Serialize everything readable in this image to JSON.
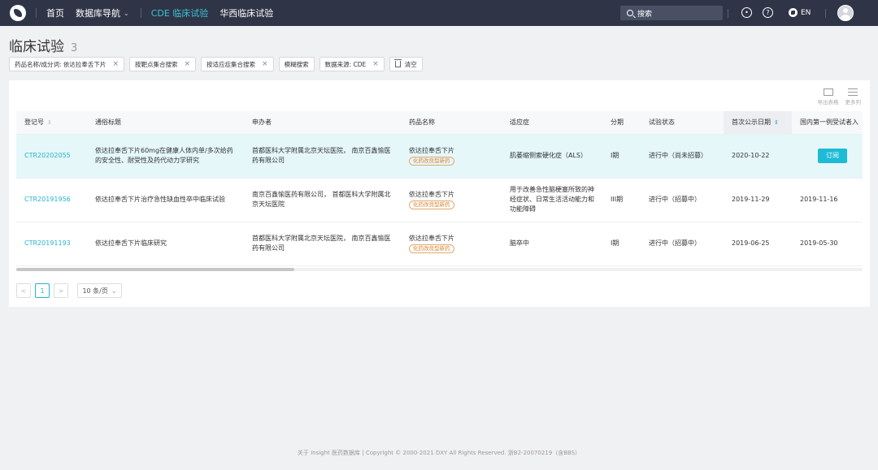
{
  "topbar": {
    "nav": [
      {
        "label": "首页",
        "active": false
      },
      {
        "label": "数据库导航",
        "active": false,
        "dropdown": true
      },
      {
        "label": "CDE 临床试验",
        "active": true
      },
      {
        "label": "华西临床试验",
        "active": false
      }
    ],
    "search_label": "搜索",
    "lang_label": "EN",
    "icons": [
      "logo-icon",
      "search-icon",
      "lightbulb-icon",
      "help-icon",
      "globe-icon",
      "avatar"
    ]
  },
  "page": {
    "title": "临床试验",
    "count": "3"
  },
  "filters": [
    {
      "label": "药品名称/成分词: 依达拉奉舌下片",
      "closable": true
    },
    {
      "label": "按靶点集合搜索",
      "closable": true
    },
    {
      "label": "按适应症集合搜索",
      "closable": true
    },
    {
      "label": "模糊搜索",
      "closable": false
    },
    {
      "label": "数据来源: CDE",
      "closable": true
    },
    {
      "label": "清空",
      "closable": false,
      "icon": "trash-icon"
    }
  ],
  "tools": {
    "export": "导出表格",
    "more_columns": "更多列"
  },
  "table": {
    "columns": [
      "登记号",
      "通俗标题",
      "申办者",
      "药品名称",
      "适应症",
      "分期",
      "试验状态",
      "首次公示日期",
      "国内第一例受试者入"
    ],
    "rows": [
      {
        "reg_no": "CTR20202055",
        "title": "依达拉奉舌下片60mg在健康人体内单/多次给药的安全性、耐受性及药代动力学研究",
        "sponsor": "首都医科大学附属北京天坛医院， 南京百鑫愉医药有限公司",
        "drug": "依达拉奉舌下片",
        "drug_tag": "化药改良型新药",
        "indication": "肌萎缩侧索硬化症（ALS）",
        "phase": "I期",
        "status": "进行中（尚未招募）",
        "first_date": "2020-10-22",
        "first_subject": "",
        "action": "订阅"
      },
      {
        "reg_no": "CTR20191956",
        "title": "依达拉奉舌下片治疗急性缺血性卒中临床试验",
        "sponsor": "南京百鑫愉医药有限公司， 首都医科大学附属北京天坛医院",
        "drug": "依达拉奉舌下片",
        "drug_tag": "化药改良型新药",
        "indication": "用于改善急性脑梗塞所致的神经症状、日常生活活动能力和功能障碍",
        "phase": "III期",
        "status": "进行中（招募中）",
        "first_date": "2019-11-29",
        "first_subject": "2019-11-16",
        "action": ""
      },
      {
        "reg_no": "CTR20191193",
        "title": "依达拉奉舌下片临床研究",
        "sponsor": "首都医科大学附属北京天坛医院， 南京百鑫愉医药有限公司",
        "drug": "依达拉奉舌下片",
        "drug_tag": "化药改良型新药",
        "indication": "脑卒中",
        "phase": "I期",
        "status": "进行中（招募中）",
        "first_date": "2019-06-25",
        "first_subject": "2019-05-30",
        "action": ""
      }
    ]
  },
  "pager": {
    "prev": "<",
    "current": "1",
    "next": ">",
    "page_size": "10 条/页"
  },
  "footer": "关于 Insight 医药数据库 | Copyright © 2000-2021 DXY All Rights Reserved. 浙B2-20070219（含BBS）",
  "colors": {
    "topbar": "#2f3547",
    "accent": "#1ebbd6",
    "highlight_row": "#e6f7fa",
    "tag_orange": "#e0812e"
  }
}
